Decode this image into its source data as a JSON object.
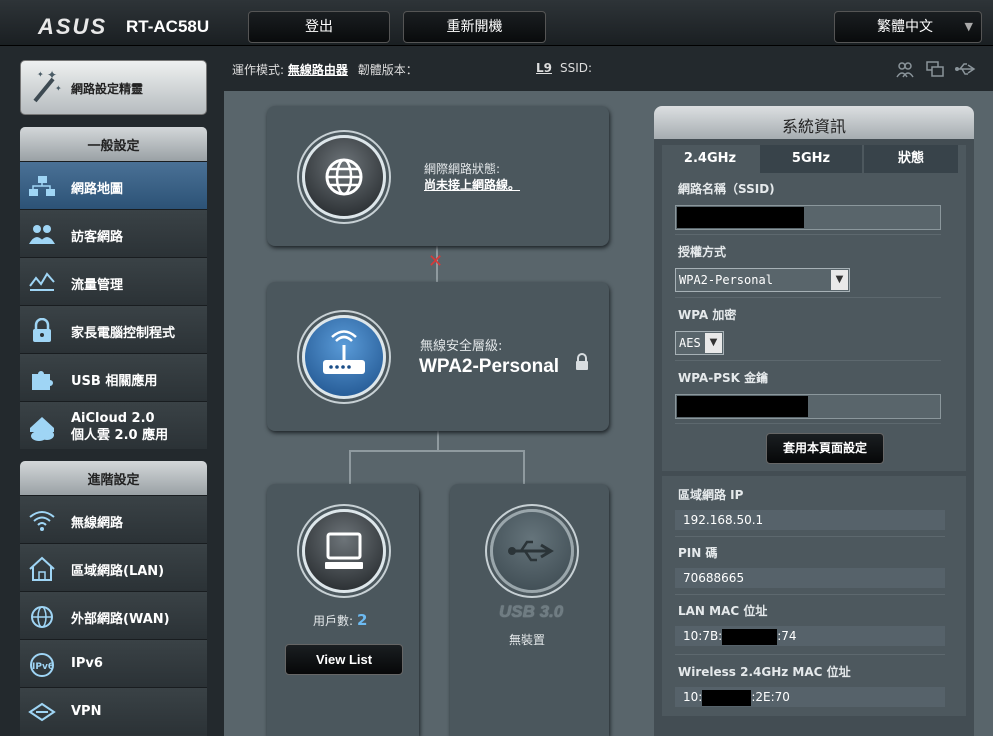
{
  "brand": {
    "logo": "ASUS",
    "model": "RT-AC58U"
  },
  "topbar": {
    "logout": "登出",
    "reboot": "重新開機",
    "language": "繁體中文"
  },
  "status": {
    "op_mode_label": "運作模式:",
    "op_mode": "無線路由器",
    "firmware_label": "韌體版本：",
    "ssid_prefix": "L9",
    "ssid_label": "SSID:"
  },
  "wizard": {
    "label": "網路設定精靈"
  },
  "general": {
    "title": "一般設定",
    "items": [
      {
        "label": "網路地圖",
        "icon": "network-map-icon"
      },
      {
        "label": "訪客網路",
        "icon": "guest-network-icon"
      },
      {
        "label": "流量管理",
        "icon": "traffic-manager-icon"
      },
      {
        "label": "家長電腦控制程式",
        "icon": "parental-lock-icon"
      },
      {
        "label": "USB 相關應用",
        "icon": "usb-puzzle-icon"
      },
      {
        "label": "AiCloud 2.0",
        "label2": "個人雲 2.0 應用",
        "icon": "aicloud-icon"
      }
    ]
  },
  "advanced": {
    "title": "進階設定",
    "items": [
      {
        "label": "無線網路",
        "icon": "wifi-icon"
      },
      {
        "label": "區域網路(LAN)",
        "icon": "home-icon"
      },
      {
        "label": "外部網路(WAN)",
        "icon": "globe-icon"
      },
      {
        "label": "IPv6",
        "icon": "ipv6-icon"
      },
      {
        "label": "VPN",
        "icon": "vpn-icon"
      }
    ]
  },
  "map": {
    "internet_label": "網際網路狀態:",
    "internet_status": "尚未接上網路線。",
    "security_label": "無線安全層級:",
    "security_value": "WPA2-Personal",
    "clients_label": "用戶數:",
    "clients_count": "2",
    "view_list": "View List",
    "usb_label": "USB 3.0",
    "usb_status": "無裝置"
  },
  "sysinfo": {
    "title": "系統資訊",
    "tabs": [
      "2.4GHz",
      "5GHz",
      "狀態"
    ],
    "ssid_label": "網路名稱（SSID)",
    "auth_label": "授權方式",
    "auth_value": "WPA2-Personal",
    "wpa_enc_label": "WPA 加密",
    "wpa_enc_value": "AES",
    "psk_label": "WPA-PSK 金鑰",
    "apply": "套用本頁面設定",
    "lan_ip_label": "區域網路 IP",
    "lan_ip": "192.168.50.1",
    "pin_label": "PIN 碼",
    "pin": "70688665",
    "lan_mac_label": "LAN MAC 位址",
    "lan_mac_a": "10:7B:",
    "lan_mac_b": ":74",
    "wl_mac_label": "Wireless 2.4GHz MAC 位址",
    "wl_mac_a": "10:",
    "wl_mac_b": ":2E:70"
  }
}
